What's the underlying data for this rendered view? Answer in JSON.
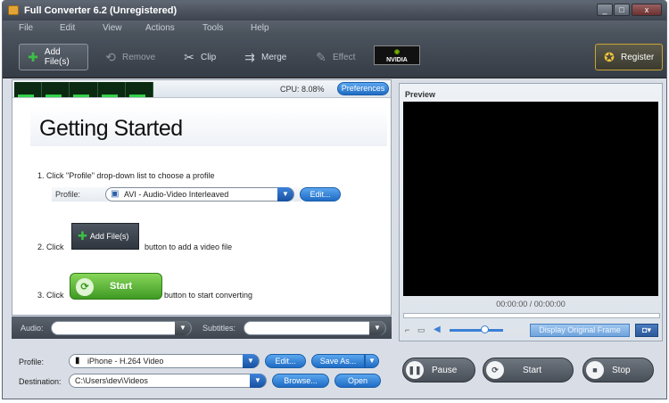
{
  "window": {
    "title": "Full Converter 6.2 (Unregistered)",
    "controls": {
      "minimize": "_",
      "maximize": "□",
      "close": "x"
    }
  },
  "menu": [
    "File",
    "Edit",
    "View",
    "Actions",
    "Tools",
    "Help"
  ],
  "toolbar": {
    "add_files": "Add File(s)",
    "remove": "Remove",
    "clip": "Clip",
    "merge": "Merge",
    "effect": "Effect",
    "nvidia_badge": "NVIDIA",
    "register": "Register"
  },
  "status": {
    "cpu": "CPU: 8.08%",
    "preferences": "Preferences"
  },
  "getting_started": {
    "title": "Getting Started",
    "step1": "1. Click \"Profile\" drop-down list to choose a profile",
    "profile_label": "Profile:",
    "profile_value": "AVI - Audio-Video Interleaved",
    "edit": "Edit...",
    "step2_prefix": "2. Click",
    "step2_button": "Add File(s)",
    "step2_suffix": "button to add a video file",
    "step3_prefix": "3. Click",
    "step3_button": "Start",
    "step3_suffix": "button to start converting"
  },
  "tracks": {
    "audio_label": "Audio:",
    "audio_value": "",
    "subtitles_label": "Subtitles:",
    "subtitles_value": ""
  },
  "output": {
    "profile_label": "Profile:",
    "profile_value": "iPhone - H.264 Video",
    "edit": "Edit...",
    "save_as": "Save As...",
    "destination_label": "Destination:",
    "destination_value": "C:\\Users\\dev\\Videos",
    "browse": "Browse...",
    "open": "Open"
  },
  "preview": {
    "label": "Preview",
    "time": "00:00:00 / 00:00:00",
    "volume_level": 0.65,
    "display_original_frame": "Display Original Frame"
  },
  "transport": {
    "pause": "Pause",
    "start": "Start",
    "stop": "Stop"
  },
  "icons": {
    "add": "plus-icon",
    "remove": "remove-icon",
    "clip": "scissors-icon",
    "merge": "merge-icon",
    "effect": "wand-icon",
    "register": "badge-icon",
    "snapshot": "camera-icon"
  },
  "colors": {
    "accent_blue": "#1f6cc4",
    "start_green": "#3f9a23",
    "chrome_dark": "#3d444e",
    "preview_black": "#000000"
  }
}
